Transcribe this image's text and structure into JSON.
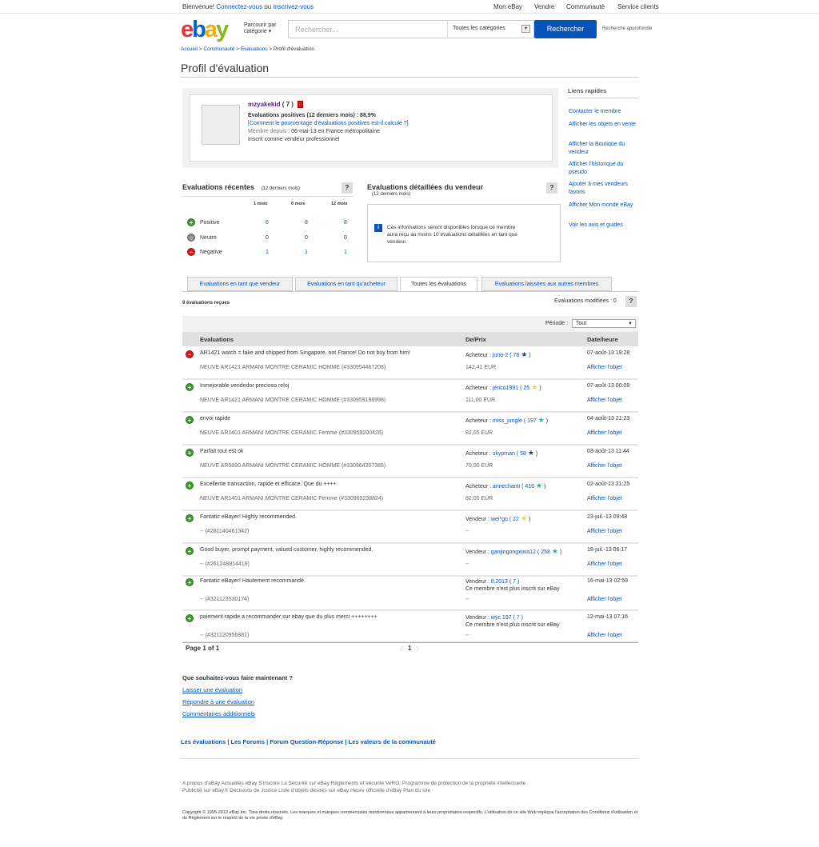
{
  "topbar": {
    "greeting": "Bienvenue!",
    "signin": "Connectez-vous",
    "or": "ou",
    "register": "inscrivez-vous",
    "nav": [
      "Mon eBay",
      "Vendre",
      "Communauté",
      "Service clients"
    ]
  },
  "header": {
    "logo": [
      "e",
      "b",
      "a",
      "y"
    ],
    "browse": "Parcourir par catégorie",
    "search_placeholder": "Rechercher...",
    "category": "Toutes les catégories",
    "search_button": "Rechercher",
    "advanced": "Recherche approfondie"
  },
  "breadcrumb": [
    "Accueil",
    "Communauté",
    "Evaluations",
    "Profil d'évaluation"
  ],
  "page_title": "Profil d'évaluation",
  "profile": {
    "username": "mzyakekid",
    "score": "( 7 )",
    "positive": "Evaluations positives (12 derniers mois) : 88,9%",
    "how_calc": "[Comment le pourcentage d'évaluations positives est-il calculé ?]",
    "member_since_label": "Membre depuis",
    "member_since": " : 06-mai-13 en France métropolitaine",
    "pro": "Inscrit comme vendeur professionnel"
  },
  "quick_links": {
    "title": "Liens rapides",
    "items": [
      "Contacter le membre",
      "Afficher les objets en vente",
      "Afficher la Boutique du vendeur",
      "Afficher l'historique du pseudo",
      "Ajouter à mes vendeurs favoris",
      "Afficher Mon monde eBay",
      "Voir les avis et guides"
    ]
  },
  "recent": {
    "title": "Evaluations récentes",
    "period": "(12 derniers mois)",
    "help": "?",
    "columns": [
      "1 mois",
      "6 mois",
      "12 mois"
    ],
    "rows": [
      {
        "label": "Positive",
        "values": [
          "6",
          "8",
          "8"
        ]
      },
      {
        "label": "Neutre",
        "values": [
          "0",
          "0",
          "0"
        ]
      },
      {
        "label": "Négative",
        "values": [
          "1",
          "1",
          "1"
        ]
      }
    ]
  },
  "detailed": {
    "title": "Evaluations détaillées du vendeur",
    "period": "(12 derniers mois)",
    "help": "?",
    "info": "Ces informations seront disponibles lorsque ce membre aura reçu au moins 10 évaluations détaillées en tant que vendeur.",
    "info_icon": "i"
  },
  "tabs": [
    "Evaluations en tant que vendeur",
    "Evaluations en tant qu'acheteur",
    "Toutes les évaluations",
    "Evaluations laissées aux autres membres"
  ],
  "count": "9 évaluations reçues",
  "modified": "Evaluations modifiées : 0",
  "modified_help": "?",
  "filter": {
    "label": "Période :",
    "value": "Tout"
  },
  "table_headers": [
    "Evaluations",
    "De/Prix",
    "Date/heure"
  ],
  "feedback": [
    {
      "type": "neg",
      "comment": "AR1421 watch = fake and shipped from Singapore, not France! Do not buy from him!",
      "item": "NEUVE AR1421 ARMANI MONTRE CERAMIC HOMME (#330954467208)",
      "role": "Acheteur :",
      "user": "juno-2",
      "score": "( 78",
      "star": "★",
      "star_color": "#1a3aa6",
      "close": ")",
      "price": "142,41 EUR",
      "date": "07-août-13 19:28",
      "link": "Afficher l'objet"
    },
    {
      "type": "pos",
      "comment": "Inmejorable vendedor precioso reloj",
      "item": "NEUVE AR1421 ARMANI MONTRE CERAMIC HOMME (#330959198998)",
      "role": "Acheteur :",
      "user": "jerico1991",
      "score": "( 25",
      "star": "★",
      "star_color": "#f2d31b",
      "close": ")",
      "price": "111,00 EUR",
      "date": "07-août-13 00:09",
      "link": "Afficher l'objet"
    },
    {
      "type": "pos",
      "comment": "envoi rapide",
      "item": "NEUVE AR1401 ARMANI MONTRE CERAMIC Femme (#330959200426)",
      "role": "Acheteur :",
      "user": "miss_jungle",
      "score": "( 197",
      "star": "★",
      "star_color": "#2bb39a",
      "close": ")",
      "price": "82,05 EUR",
      "date": "04-août-13 21:23",
      "link": "Afficher l'objet"
    },
    {
      "type": "pos",
      "comment": "Parfait tout est ok",
      "item": "NEUVE AR5890 ARMANI MONTRE CERAMIC HOMME (#330964307385)",
      "role": "Acheteur :",
      "user": "skypman",
      "score": "( 58",
      "star": "★",
      "star_color": "#1a3aa6",
      "close": ")",
      "price": "70,00 EUR",
      "date": "03-août-13 11:44",
      "link": "Afficher l'objet"
    },
    {
      "type": "pos",
      "comment": "Excellente transaction, rapide et efficace. Que du ++++",
      "item": "NEUVE AR1401 ARMANI MONTRE CERAMIC Femme (#330965238824)",
      "role": "Acheteur :",
      "user": "annechanti",
      "score": "( 416",
      "star": "★",
      "star_color": "#2bb39a",
      "close": ")",
      "price": "82,05 EUR",
      "date": "02-août-13 21:25",
      "link": "Afficher l'objet"
    },
    {
      "type": "pos",
      "comment": "Fantatic eBayer! Highly recommended.",
      "item": "-- (#281140461342)",
      "role": "Vendeur :",
      "user": "wei*go",
      "score": "( 22",
      "star": "★",
      "star_color": "#f2d31b",
      "close": ")",
      "price": "--",
      "date": "23-juil.-13 09:48",
      "link": "Afficher l'objet"
    },
    {
      "type": "pos",
      "comment": "Good buyer, prompt payment, valued customer, highly recommended.",
      "item": "-- (#261248814419)",
      "role": "Vendeur :",
      "user": "ganjingongxixia12",
      "score": "( 258",
      "star": "★",
      "star_color": "#2bb39a",
      "close": ")",
      "price": "--",
      "date": "18-juil.-13 06:17",
      "link": "Afficher l'objet"
    },
    {
      "type": "pos",
      "comment": "Fantatic eBayer! Hautement recommandé.",
      "item": "-- (#321123530174)",
      "role": "Vendeur :",
      "user": "tl.2013",
      "score": "( 7 )",
      "star": "",
      "star_color": "",
      "close": "",
      "price": "Ce membre n'est plus inscrit sur eBay",
      "date": "16-mai-13 02:59",
      "link": "Afficher l'objet"
    },
    {
      "type": "pos",
      "comment": "paiement rapide a recommander sur ebay que du plus merci ++++++++",
      "item": "-- (#321120956881)",
      "role": "Vendeur :",
      "user": "wyc.197",
      "score": "( 7 )",
      "star": "",
      "star_color": "",
      "close": "",
      "price": "Ce membre n'est plus inscrit sur eBay",
      "date": "12-mai-13 07:16",
      "link": "Afficher l'objet"
    }
  ],
  "pager": {
    "label": "Page 1 of 1",
    "prev": "〈",
    "current": "1",
    "next": "〉"
  },
  "whatnow": {
    "title": "Que souhaitez-vous faire maintenant ?",
    "links": [
      "Laisser une évaluation",
      "Répondre à une évaluation",
      "Commentaires additionnels"
    ]
  },
  "community_links": "Les évaluations | Les Forums | Forum Question-Réponse | Les valeurs de la communauté",
  "footer": {
    "line1": "A propos d'eBay    Actualités eBay    S'inscrire    La Sécurité sur eBay    Règlements et sécurité    VeRO: Programme de protection de la propriété intellectuelle",
    "line2": "Publicité sur eBay.fr    Décisions de Justice    Liste d'objets désirés sur eBay    Heure officielle d'eBay    Plan du site",
    "copyright": "Copyright © 1995-2013 eBay Inc. Tous droits réservés. Les marques et marques commerciales mentionnées appartiennent à leurs propriétaires respectifs. L'utilisation de ce site Web implique l'acceptation des Conditions d'utilisation et du Règlement sur le respect de la vie privée d'eBay."
  },
  "colors": {
    "link": "#0654ba",
    "positive": "#3c9a2b",
    "negative": "#d11d1d",
    "username": "#5e248f"
  },
  "icons": {
    "positive": "plus-circle-icon",
    "neutral": "neutral-circle-icon",
    "negative": "minus-circle-icon",
    "info": "info-icon",
    "help": "question-icon",
    "star": "star-icon",
    "seller_badge": "seller-badge-icon"
  }
}
